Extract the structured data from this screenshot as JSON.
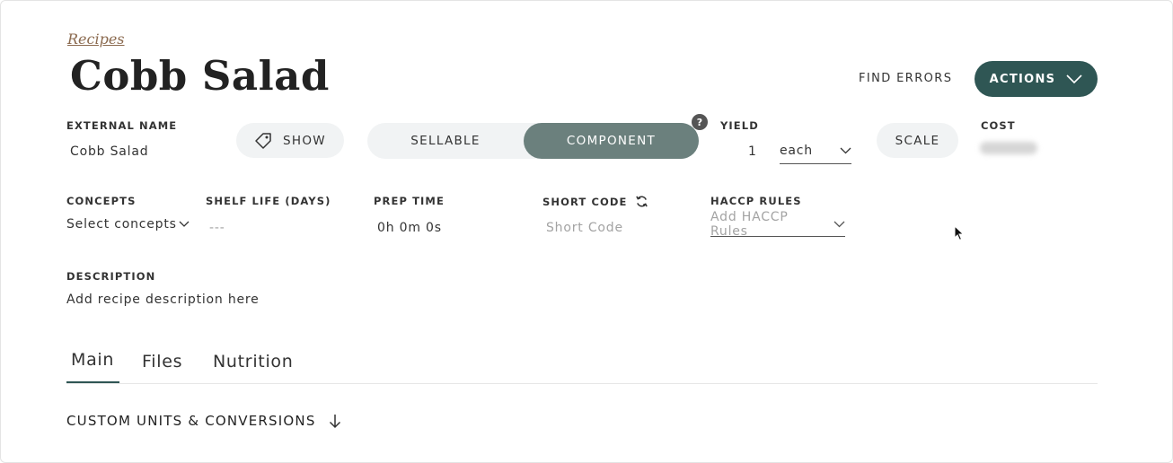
{
  "breadcrumb": "Recipes",
  "title": "Cobb Salad",
  "header": {
    "find_errors": "FIND ERRORS",
    "actions": "ACTIONS"
  },
  "fields": {
    "external_name_label": "EXTERNAL NAME",
    "external_name_value": "Cobb Salad",
    "show_button": "SHOW",
    "sellable": "SELLABLE",
    "component": "COMPONENT",
    "help": "?",
    "yield_label": "YIELD",
    "yield_qty": "1",
    "yield_unit": "each",
    "scale_button": "SCALE",
    "cost_label": "COST",
    "concepts_label": "CONCEPTS",
    "concepts_value": "Select concepts",
    "shelf_life_label": "SHELF LIFE (DAYS)",
    "shelf_life_value": "---",
    "prep_time_label": "PREP TIME",
    "prep_time_value": "0h 0m 0s",
    "short_code_label": "SHORT CODE",
    "short_code_placeholder": "Short Code",
    "haccp_label": "HACCP RULES",
    "haccp_placeholder": "Add HACCP Rules",
    "description_label": "DESCRIPTION",
    "description_placeholder": "Add recipe description here"
  },
  "tabs": [
    {
      "label": "Main",
      "active": true
    },
    {
      "label": "Files",
      "active": false
    },
    {
      "label": "Nutrition",
      "active": false
    }
  ],
  "section": {
    "custom_units": "CUSTOM UNITS & CONVERSIONS"
  },
  "colors": {
    "accent": "#2f5654",
    "toggle_active": "#6b807d",
    "breadcrumb": "#8b6a4f"
  }
}
